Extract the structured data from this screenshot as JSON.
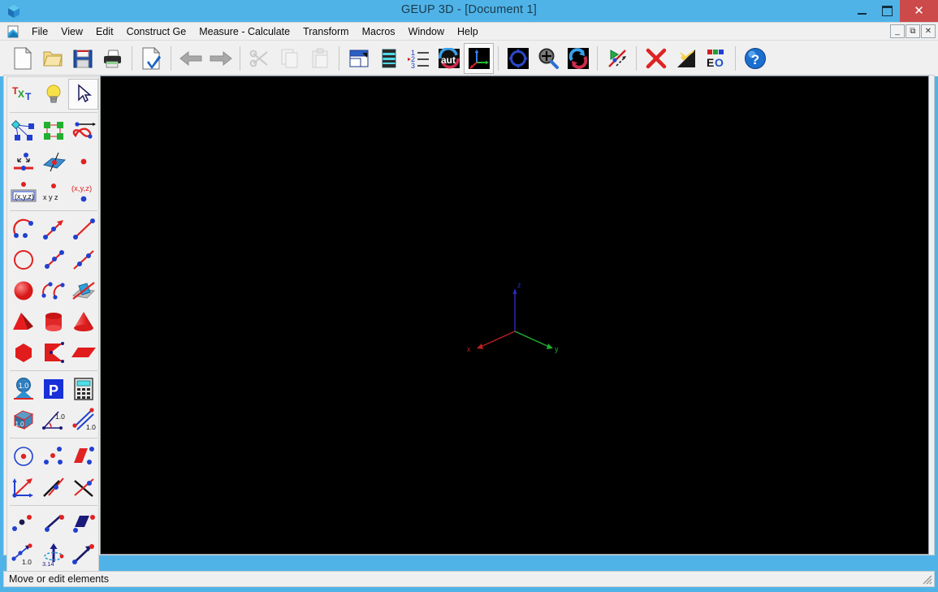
{
  "window": {
    "title": "GEUP 3D - [Document 1]",
    "app_icon": "cube-icon",
    "controls": {
      "minimize": "–",
      "maximize": "❐",
      "close": "✕"
    },
    "mdi_controls": {
      "minimize": "_",
      "restore": "❐",
      "close": "✕"
    },
    "colors": {
      "titlebar": "#4fb3e8",
      "close_button": "#cc4a4a",
      "chrome": "#f0f0f0",
      "canvas": "#000000"
    }
  },
  "menubar": {
    "doc_icon": "document-icon",
    "items": [
      {
        "label": "File",
        "name": "menu-file"
      },
      {
        "label": "View",
        "name": "menu-view"
      },
      {
        "label": "Edit",
        "name": "menu-edit"
      },
      {
        "label": "Construct Ge",
        "name": "menu-construct"
      },
      {
        "label": "Measure - Calculate",
        "name": "menu-measure-calculate"
      },
      {
        "label": "Transform",
        "name": "menu-transform"
      },
      {
        "label": "Macros",
        "name": "menu-macros"
      },
      {
        "label": "Window",
        "name": "menu-window"
      },
      {
        "label": "Help",
        "name": "menu-help"
      }
    ]
  },
  "toolbar": {
    "groups": [
      {
        "buttons": [
          {
            "name": "new-document-button",
            "icon": "new-document-icon",
            "active": false,
            "disabled": false
          },
          {
            "name": "open-button",
            "icon": "open-folder-icon",
            "active": false,
            "disabled": false
          },
          {
            "name": "save-button",
            "icon": "floppy-disk-icon",
            "active": false,
            "disabled": false
          },
          {
            "name": "print-button",
            "icon": "printer-icon",
            "active": false,
            "disabled": false
          }
        ]
      },
      {
        "buttons": [
          {
            "name": "document-properties-button",
            "icon": "document-check-icon",
            "active": false,
            "disabled": false
          }
        ]
      },
      {
        "buttons": [
          {
            "name": "undo-button",
            "icon": "arrow-left-icon",
            "active": false,
            "disabled": true
          },
          {
            "name": "redo-button",
            "icon": "arrow-right-icon",
            "active": false,
            "disabled": true
          }
        ]
      },
      {
        "buttons": [
          {
            "name": "cut-button",
            "icon": "scissors-icon",
            "active": false,
            "disabled": true
          },
          {
            "name": "copy-button",
            "icon": "copy-icon",
            "active": false,
            "disabled": true
          },
          {
            "name": "paste-button",
            "icon": "clipboard-paste-icon",
            "active": false,
            "disabled": true
          }
        ]
      },
      {
        "buttons": [
          {
            "name": "view-window-button",
            "icon": "window-panel-icon",
            "active": false,
            "disabled": false
          },
          {
            "name": "animation-film-button",
            "icon": "film-strip-icon",
            "active": false,
            "disabled": false
          },
          {
            "name": "sequence-button",
            "icon": "numbered-list-icon",
            "active": false,
            "disabled": false
          },
          {
            "name": "auto-button",
            "icon": "aut-icon",
            "active": false,
            "disabled": false
          },
          {
            "name": "show-axes-button",
            "icon": "axes-icon",
            "active": true,
            "disabled": false
          }
        ]
      },
      {
        "buttons": [
          {
            "name": "pan-view-button",
            "icon": "pan-arrows-icon",
            "active": false,
            "disabled": false
          },
          {
            "name": "zoom-button",
            "icon": "magnifier-plus-icon",
            "active": false,
            "disabled": false
          },
          {
            "name": "rotate-view-button",
            "icon": "rotate-arrows-icon",
            "active": false,
            "disabled": false
          }
        ]
      },
      {
        "buttons": [
          {
            "name": "trace-button",
            "icon": "trace-path-icon",
            "active": false,
            "disabled": false
          }
        ]
      },
      {
        "buttons": [
          {
            "name": "delete-button",
            "icon": "red-x-icon",
            "active": false,
            "disabled": false
          },
          {
            "name": "lighting-button",
            "icon": "light-effect-icon",
            "active": false,
            "disabled": false
          },
          {
            "name": "color-eo-button",
            "icon": "eo-color-icon",
            "active": false,
            "disabled": false
          }
        ]
      },
      {
        "buttons": [
          {
            "name": "help-button",
            "icon": "help-question-icon",
            "active": false,
            "disabled": false
          }
        ]
      }
    ]
  },
  "palette": {
    "rows": [
      {
        "separator_after": true,
        "cells": [
          {
            "name": "tool-text",
            "icon": "txt-label-icon",
            "active": false
          },
          {
            "name": "tool-hint",
            "icon": "lightbulb-icon",
            "active": false
          },
          {
            "name": "tool-select",
            "icon": "cursor-arrow-icon",
            "active": true
          }
        ]
      },
      {
        "separator_after": false,
        "cells": [
          {
            "name": "tool-graph-node",
            "icon": "graph-node-icon",
            "active": false
          },
          {
            "name": "tool-grid-points",
            "icon": "grid-points-icon",
            "active": false
          },
          {
            "name": "tool-locus",
            "icon": "locus-loop-icon",
            "active": false
          }
        ]
      },
      {
        "separator_after": false,
        "cells": [
          {
            "name": "tool-point-on-line",
            "icon": "point-on-line-icon",
            "active": false
          },
          {
            "name": "tool-point-on-plane",
            "icon": "point-on-plane-icon",
            "active": false
          },
          {
            "name": "tool-point",
            "icon": "red-point-icon",
            "active": false
          }
        ]
      },
      {
        "separator_after": true,
        "cells": [
          {
            "name": "tool-coordinates-box",
            "icon": "xyz-box-icon",
            "active": false
          },
          {
            "name": "tool-coordinates-xyz",
            "icon": "xyz-text-icon",
            "active": false
          },
          {
            "name": "tool-point-by-coordinates",
            "icon": "xyz-point-icon",
            "active": false
          }
        ]
      },
      {
        "separator_after": false,
        "cells": [
          {
            "name": "tool-arc",
            "icon": "arc-icon",
            "active": false
          },
          {
            "name": "tool-ray",
            "icon": "ray-arrow-icon",
            "active": false
          },
          {
            "name": "tool-segment",
            "icon": "segment-icon",
            "active": false
          }
        ]
      },
      {
        "separator_after": false,
        "cells": [
          {
            "name": "tool-circle",
            "icon": "circle-outline-icon",
            "active": false
          },
          {
            "name": "tool-segment-points",
            "icon": "segment-points-icon",
            "active": false
          },
          {
            "name": "tool-line",
            "icon": "line-icon",
            "active": false
          }
        ]
      },
      {
        "separator_after": false,
        "cells": [
          {
            "name": "tool-sphere",
            "icon": "sphere-icon",
            "active": false
          },
          {
            "name": "tool-arcs-pair",
            "icon": "arcs-pair-icon",
            "active": false
          },
          {
            "name": "tool-plane-line-intersection",
            "icon": "plane-line-icon",
            "active": false
          }
        ]
      },
      {
        "separator_after": false,
        "cells": [
          {
            "name": "tool-pyramid",
            "icon": "pyramid-icon",
            "active": false
          },
          {
            "name": "tool-cylinder",
            "icon": "cylinder-icon",
            "active": false
          },
          {
            "name": "tool-cone",
            "icon": "cone-icon",
            "active": false
          }
        ]
      },
      {
        "separator_after": true,
        "cells": [
          {
            "name": "tool-polyhedron",
            "icon": "hexagon-solid-icon",
            "active": false
          },
          {
            "name": "tool-concave-polygon",
            "icon": "concave-polygon-icon",
            "active": false
          },
          {
            "name": "tool-parallelogram",
            "icon": "parallelogram-icon",
            "active": false
          }
        ]
      },
      {
        "separator_after": false,
        "cells": [
          {
            "name": "tool-measure-area",
            "icon": "area-measure-icon",
            "active": false
          },
          {
            "name": "tool-perimeter",
            "icon": "p-square-icon",
            "active": false
          },
          {
            "name": "tool-calculator",
            "icon": "calculator-icon",
            "active": false
          }
        ]
      },
      {
        "separator_after": true,
        "cells": [
          {
            "name": "tool-volume",
            "icon": "volume-cube-icon",
            "active": false
          },
          {
            "name": "tool-angle",
            "icon": "angle-measure-icon",
            "active": false
          },
          {
            "name": "tool-distance",
            "icon": "distance-measure-icon",
            "active": false
          }
        ]
      },
      {
        "separator_after": false,
        "cells": [
          {
            "name": "tool-circle-center",
            "icon": "circle-center-icon",
            "active": false
          },
          {
            "name": "tool-midpoint",
            "icon": "midpoint-icon",
            "active": false
          },
          {
            "name": "tool-segment-bar",
            "icon": "red-bar-icon",
            "active": false
          }
        ]
      },
      {
        "separator_after": true,
        "cells": [
          {
            "name": "tool-vector",
            "icon": "vectors-icon",
            "active": false
          },
          {
            "name": "tool-parallel",
            "icon": "parallel-lines-icon",
            "active": false
          },
          {
            "name": "tool-perpendicular",
            "icon": "crossing-lines-icon",
            "active": false
          }
        ]
      },
      {
        "separator_after": false,
        "cells": [
          {
            "name": "tool-point-symmetry",
            "icon": "point-symmetry-icon",
            "active": false
          },
          {
            "name": "tool-line-symmetry",
            "icon": "line-symmetry-icon",
            "active": false
          },
          {
            "name": "tool-plane-symmetry",
            "icon": "plane-symmetry-icon",
            "active": false
          }
        ]
      },
      {
        "separator_after": false,
        "cells": [
          {
            "name": "tool-dilation",
            "icon": "dilation-icon",
            "active": false,
            "label": "1.0"
          },
          {
            "name": "tool-rotation",
            "icon": "rotation-axis-icon",
            "active": false,
            "label": "3.14"
          },
          {
            "name": "tool-translation",
            "icon": "translation-vector-icon",
            "active": false
          }
        ]
      }
    ]
  },
  "canvas": {
    "background": "#000000",
    "axes": {
      "z": {
        "label": "z",
        "color": "#3333cc"
      },
      "x": {
        "label": "x",
        "color": "#cc2222"
      },
      "y": {
        "label": "y",
        "color": "#22aa33"
      }
    }
  },
  "statusbar": {
    "message": "Move or edit elements",
    "grip": "resize-grip-icon"
  }
}
